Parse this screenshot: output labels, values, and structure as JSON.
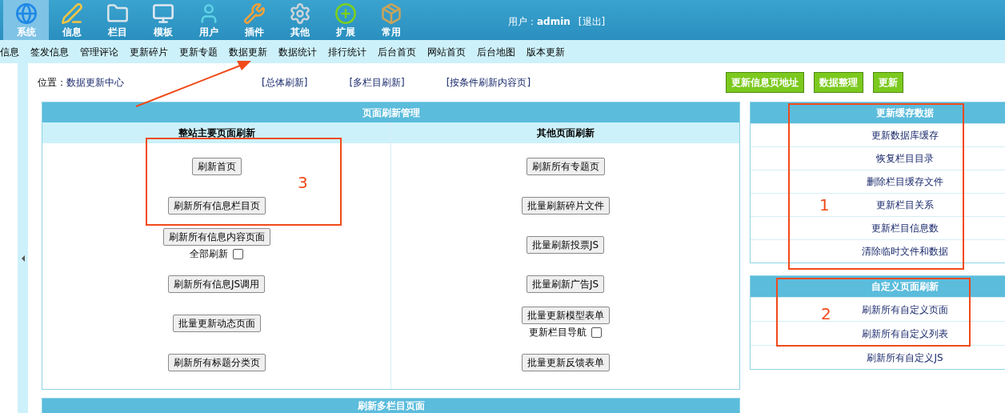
{
  "top_nav": {
    "items": [
      {
        "label": "系统",
        "selected": true
      },
      {
        "label": "信息",
        "selected": false
      },
      {
        "label": "栏目",
        "selected": false
      },
      {
        "label": "模板",
        "selected": false
      },
      {
        "label": "用户",
        "selected": false
      },
      {
        "label": "插件",
        "selected": false
      },
      {
        "label": "其他",
        "selected": false
      },
      {
        "label": "扩展",
        "selected": false
      },
      {
        "label": "常用",
        "selected": false
      }
    ],
    "user_label": "用户：",
    "user_name": "admin",
    "logout": "[退出]"
  },
  "sub_nav": [
    "信息",
    "签发信息",
    "管理评论",
    "更新碎片",
    "更新专题",
    "数据更新",
    "数据统计",
    "排行统计",
    "后台首页",
    "网站首页",
    "后台地图",
    "版本更新"
  ],
  "location": {
    "label": "位置：",
    "value": "数据更新中心"
  },
  "links": [
    "[总体刷新]",
    "[多栏目刷新]",
    "[按条件刷新内容页]"
  ],
  "action_buttons": [
    "更新信息页地址",
    "数据整理",
    "更新"
  ],
  "refresh_panel": {
    "title": "页面刷新管理",
    "left": {
      "heading": "整站主要页面刷新",
      "items": [
        {
          "kind": "button",
          "label": "刷新首页"
        },
        {
          "kind": "button",
          "label": "刷新所有信息栏目页"
        },
        {
          "kind": "button",
          "label": "刷新所有信息内容页面"
        },
        {
          "kind": "checkbox",
          "label": "全部刷新",
          "checked": false
        },
        {
          "kind": "button",
          "label": "刷新所有信息JS调用"
        },
        {
          "kind": "button",
          "label": "批量更新动态页面"
        },
        {
          "kind": "button",
          "label": "刷新所有标题分类页"
        }
      ]
    },
    "right": {
      "heading": "其他页面刷新",
      "items": [
        {
          "kind": "button",
          "label": "刷新所有专题页"
        },
        {
          "kind": "button",
          "label": "批量刷新碎片文件"
        },
        {
          "kind": "button",
          "label": "批量刷新投票JS"
        },
        {
          "kind": "button",
          "label": "批量刷新广告JS"
        },
        {
          "kind": "button",
          "label": "批量更新模型表单"
        },
        {
          "kind": "checkbox",
          "label": "更新栏目导航",
          "checked": false
        },
        {
          "kind": "button",
          "label": "批量更新反馈表单"
        }
      ]
    }
  },
  "cache_panel": {
    "title": "更新缓存数据",
    "items": [
      "更新数据库缓存",
      "恢复栏目目录",
      "删除栏目缓存文件",
      "更新栏目关系",
      "更新栏目信息数",
      "清除临时文件和数据"
    ]
  },
  "custom_panel": {
    "title": "自定义页面刷新",
    "items": [
      "刷新所有自定义页面",
      "刷新所有自定义列表",
      "刷新所有自定义JS"
    ]
  },
  "bottom_panel": {
    "title": "刷新多栏目页面"
  },
  "annotations": [
    {
      "label": "3"
    },
    {
      "label": "1"
    },
    {
      "label": "2"
    }
  ]
}
